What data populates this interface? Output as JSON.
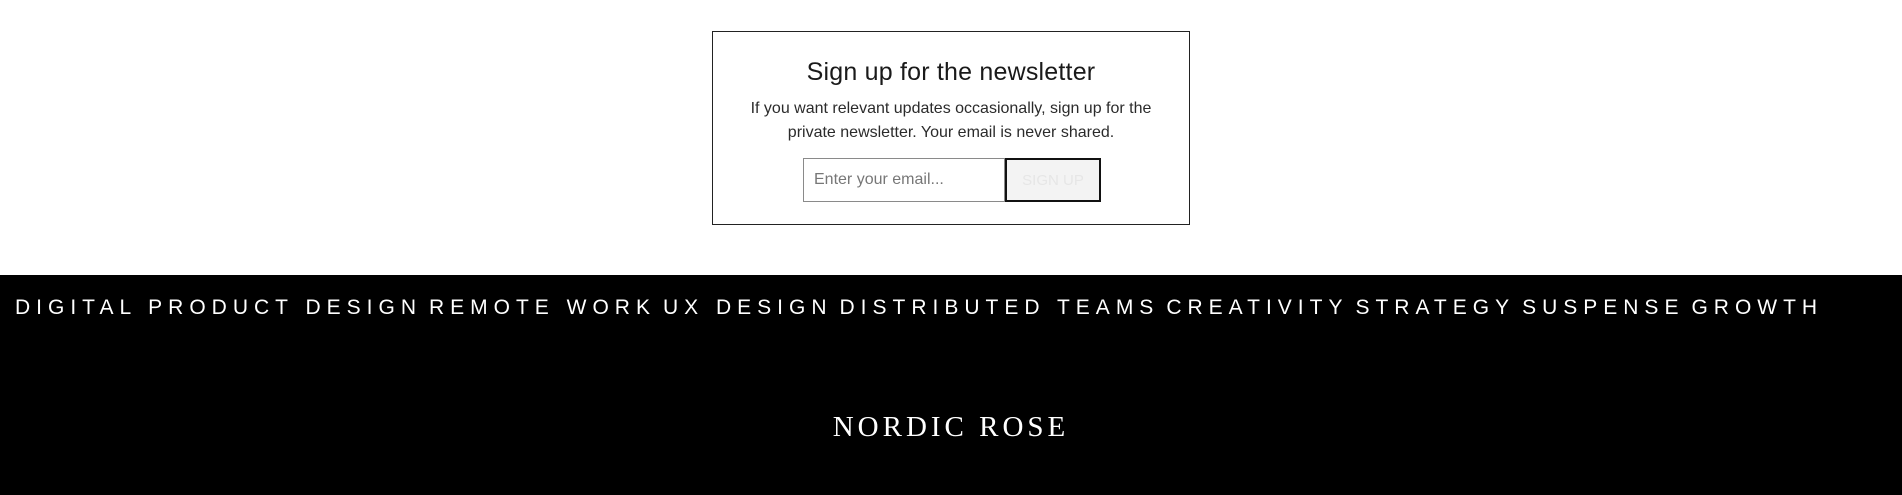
{
  "newsletter": {
    "title": "Sign up for the newsletter",
    "description": "If you want relevant updates occasionally, sign up for the private newsletter. Your email is never shared.",
    "email_placeholder": "Enter your email...",
    "signup_label": "Sign up"
  },
  "footer": {
    "tags": [
      "Digital product design",
      "Remote work",
      "UX design",
      "Distributed teams",
      "Creativity",
      "Strategy",
      "Suspense",
      "Growth"
    ],
    "brand": "NORDIC ROSE"
  },
  "colors": {
    "background": "#ffffff",
    "footer_background": "#000000",
    "text": "#1a1a1a",
    "footer_text": "#ffffff"
  }
}
